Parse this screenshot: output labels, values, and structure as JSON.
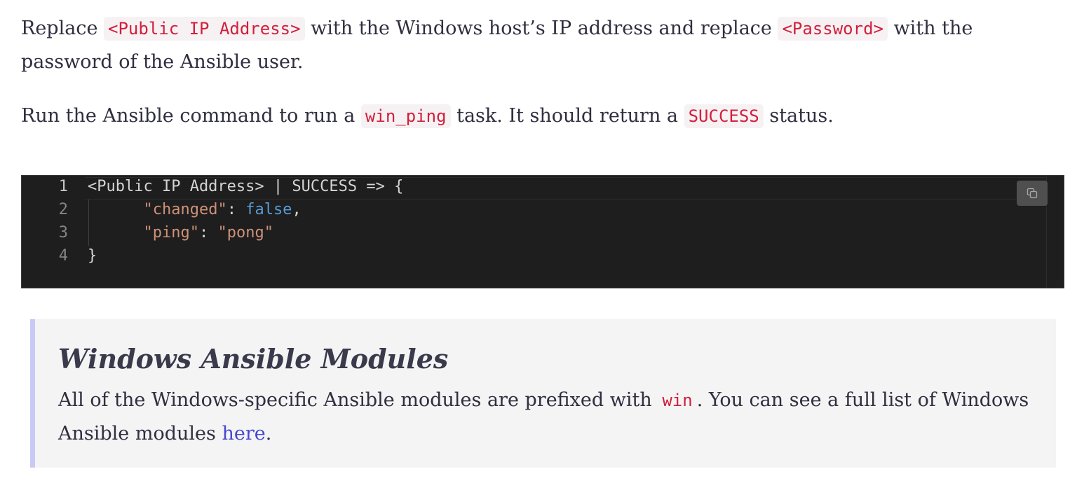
{
  "para1": {
    "t1": "Replace ",
    "code1": "<Public IP Address>",
    "t2": " with the Windows host’s IP address and replace ",
    "code2": "<Password>",
    "t3": " with the password of the Ansible user."
  },
  "para2": {
    "t1": "Run the Ansible command to run a ",
    "code1": "win_ping",
    "t2": " task. It should return a ",
    "code2": "SUCCESS",
    "t3": " status."
  },
  "codeblock": {
    "line_numbers": [
      "1",
      "2",
      "3",
      "4"
    ],
    "line1": "<Public IP Address> | SUCCESS => {",
    "line2_key": "\"changed\"",
    "line2_sep": ": ",
    "line2_val": "false",
    "line2_end": ",",
    "line3_key": "\"ping\"",
    "line3_sep": ": ",
    "line3_val": "\"pong\"",
    "line4": "}",
    "copy_icon": "copy-icon"
  },
  "callout": {
    "title": "Windows Ansible Modules",
    "t1": "All of the Windows-specific Ansible modules are prefixed with ",
    "code": "win",
    "t2": ". You can see a full list of Windows Ansible modules ",
    "link": "here",
    "t3": "."
  },
  "colors": {
    "inline_code": "#d21f3c",
    "code_bg": "#1e1e1e",
    "callout_border": "#c9c9f5",
    "link": "#4747d1"
  }
}
